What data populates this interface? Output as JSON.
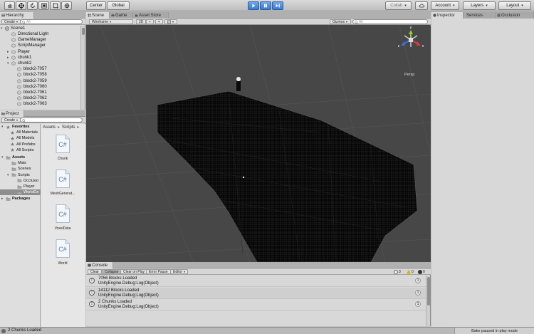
{
  "toolbar": {
    "pivot_label": "Center",
    "space_label": "Global",
    "collab_label": "Collab",
    "account_label": "Account",
    "layers_label": "Layers",
    "layout_label": "Layout"
  },
  "hierarchy": {
    "tab": "Hierarchy",
    "create_label": "Create",
    "search_placeholder": "All",
    "scene_name": "Scene1",
    "items": [
      {
        "label": "Directional Light",
        "expandable": false
      },
      {
        "label": "GameManager",
        "expandable": false
      },
      {
        "label": "ScriptManager",
        "expandable": false
      },
      {
        "label": "Player",
        "expandable": true
      },
      {
        "label": "chunk1",
        "expandable": true
      },
      {
        "label": "chunk2",
        "expandable": true,
        "expanded": true
      },
      {
        "label": "block2-7057",
        "expandable": false
      },
      {
        "label": "block2-7058",
        "expandable": false
      },
      {
        "label": "block2-7059",
        "expandable": false
      },
      {
        "label": "block2-7060",
        "expandable": false
      },
      {
        "label": "block2-7061",
        "expandable": false
      },
      {
        "label": "block2-7062",
        "expandable": false
      },
      {
        "label": "block2-7063",
        "expandable": false
      }
    ]
  },
  "project": {
    "tab": "Project",
    "create_label": "Create",
    "favorites_label": "Favorites",
    "favorites": [
      "All Materials",
      "All Models",
      "All Prefabs",
      "All Scripts"
    ],
    "assets_label": "Assets",
    "asset_folders": [
      "Mats",
      "Scenes",
      "Scripts"
    ],
    "script_folders": [
      "Occlusio",
      "Player",
      "WorldGe"
    ],
    "packages_label": "Packages",
    "breadcrumb": [
      "Assets",
      "Scripts"
    ],
    "files": [
      {
        "icon_text": "C#",
        "name": "Chunk"
      },
      {
        "icon_text": "C#",
        "name": "MeshGenerat..."
      },
      {
        "icon_text": "C#",
        "name": "VoxelData"
      },
      {
        "icon_text": "C#",
        "name": "World"
      }
    ]
  },
  "scene": {
    "tabs": [
      "Scene",
      "Game",
      "Asset Store"
    ],
    "shading_mode": "Wireframe",
    "mode_2d": "2D",
    "gizmos_label": "Gizmos",
    "search_placeholder": "All",
    "projection_label": "Persp",
    "gizmo_axes": [
      "y",
      "x",
      "z"
    ]
  },
  "console": {
    "tab": "Console",
    "buttons": [
      "Clear",
      "Collapse",
      "Clear on Play",
      "Error Pause",
      "Editor"
    ],
    "counts": {
      "info": "3",
      "warnings": "0",
      "errors": "0"
    },
    "entries": [
      {
        "line1": "7056 Blocks Loaded",
        "line2": "UnityEngine.Debug:Log(Object)",
        "count": "1"
      },
      {
        "line1": "14112 Blocks Loaded",
        "line2": "UnityEngine.Debug:Log(Object)",
        "count": "1"
      },
      {
        "line1": "2 Chunks Loaded",
        "line2": "UnityEngine.Debug:Log(Object)",
        "count": "1"
      }
    ]
  },
  "inspector": {
    "tabs": [
      "Inspector",
      "Services",
      "Occlusion"
    ]
  },
  "status": {
    "message": "2 Chunks Loaded",
    "right_text": "Bake paused in play mode"
  },
  "colors": {
    "play_blue": "#3a7bd5",
    "scene_bg": "#444444",
    "axis_x": "#e03c3c",
    "axis_y": "#8bcf3a",
    "axis_z": "#3c6fe0"
  }
}
